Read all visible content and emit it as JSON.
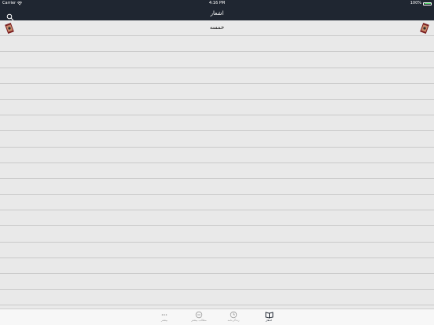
{
  "status_bar": {
    "carrier": "Carrier",
    "time": "4:16 PM",
    "battery": "100%"
  },
  "nav": {
    "title": "اشعار"
  },
  "list": {
    "items": [
      {
        "title": "خمسه"
      },
      {
        "title": ""
      },
      {
        "title": ""
      },
      {
        "title": ""
      },
      {
        "title": ""
      },
      {
        "title": ""
      },
      {
        "title": ""
      },
      {
        "title": ""
      },
      {
        "title": ""
      },
      {
        "title": ""
      },
      {
        "title": ""
      },
      {
        "title": ""
      },
      {
        "title": ""
      },
      {
        "title": ""
      },
      {
        "title": ""
      },
      {
        "title": ""
      },
      {
        "title": ""
      },
      {
        "title": ""
      },
      {
        "title": ""
      }
    ]
  },
  "tabs": [
    {
      "label": "بیشتر",
      "icon": "more-icon"
    },
    {
      "label": "مطالب بیشتر",
      "icon": "extra-content-icon"
    },
    {
      "label": "زندگی‌نامه",
      "icon": "biography-icon"
    },
    {
      "label": "اشعار",
      "icon": "book-icon",
      "active": true
    }
  ],
  "colors": {
    "bar": "#1f2631",
    "background": "#e9e9e9",
    "battery": "#4cd964"
  }
}
